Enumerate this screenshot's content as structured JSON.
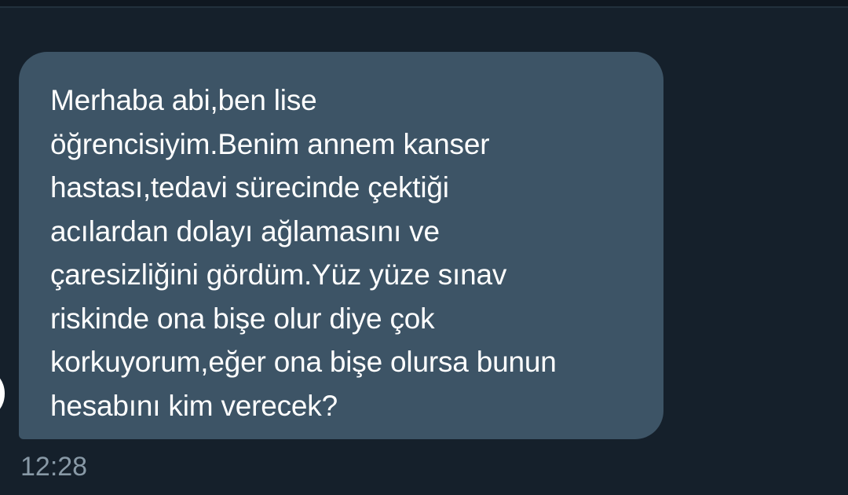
{
  "conversation": {
    "messages": [
      {
        "text": "Merhaba abi,ben lise\nöğrencisiyim.Benim annem kanser\nhastası,tedavi sürecinde çektiği\nacılardan dolayı ağlamasını ve\nçaresizliğini gördüm.Yüz yüze sınav\nriskinde ona bişe olur diye çok\nkorkuyorum,eğer ona bişe olursa bunun\nhesabını kim verecek?",
        "time": "12:28"
      }
    ]
  },
  "colors": {
    "background": "#15202b",
    "bubble": "#3d5466",
    "text": "#ffffff",
    "timestamp": "#8899a6"
  }
}
